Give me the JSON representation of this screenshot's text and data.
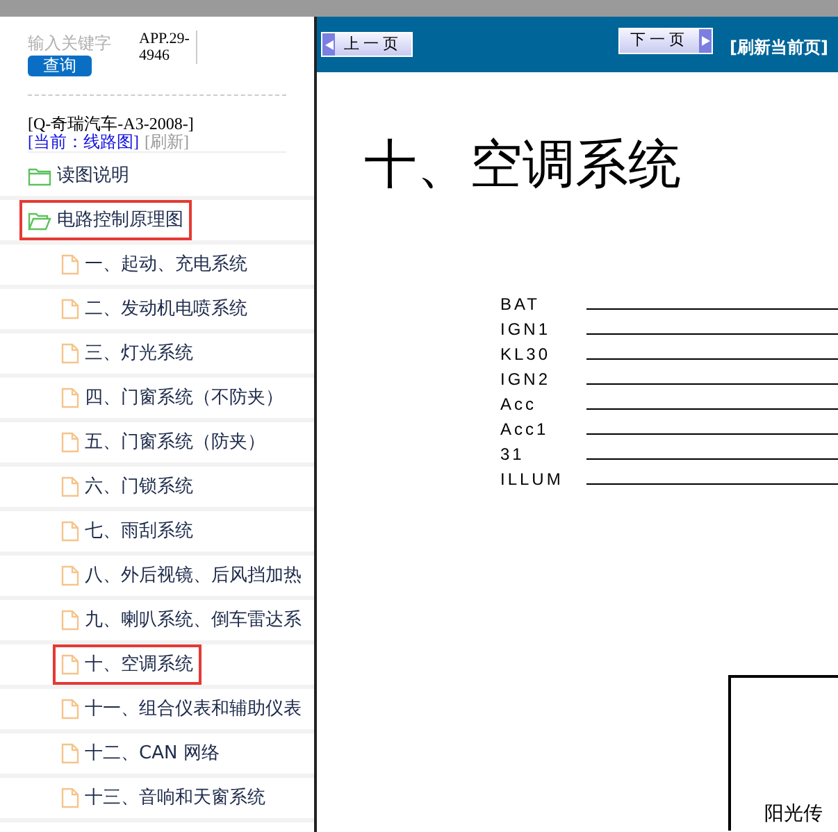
{
  "search": {
    "placeholder": "输入关键字",
    "button": "查询",
    "app_code": "APP.29-4946"
  },
  "vehicle": "[Q-奇瑞汽车-A3-2008-]",
  "current": "[当前：线路图]",
  "refresh": "[刷新]",
  "tree": [
    {
      "label": "读图说明",
      "kind": "folder",
      "expanded": false,
      "highlighted": false
    },
    {
      "label": "电路控制原理图",
      "kind": "folder",
      "expanded": true,
      "highlighted": true,
      "children": [
        {
          "label": "一、起动、充电系统",
          "kind": "page",
          "highlighted": false
        },
        {
          "label": "二、发动机电喷系统",
          "kind": "page",
          "highlighted": false
        },
        {
          "label": "三、灯光系统",
          "kind": "page",
          "highlighted": false
        },
        {
          "label": "四、门窗系统（不防夹）",
          "kind": "page",
          "highlighted": false
        },
        {
          "label": "五、门窗系统（防夹）",
          "kind": "page",
          "highlighted": false
        },
        {
          "label": "六、门锁系统",
          "kind": "page",
          "highlighted": false
        },
        {
          "label": "七、雨刮系统",
          "kind": "page",
          "highlighted": false
        },
        {
          "label": "八、外后视镜、后风挡加热",
          "kind": "page",
          "highlighted": false
        },
        {
          "label": "九、喇叭系统、倒车雷达系",
          "kind": "page",
          "highlighted": false
        },
        {
          "label": "十、空调系统",
          "kind": "page",
          "highlighted": true
        },
        {
          "label": "十一、组合仪表和辅助仪表",
          "kind": "page",
          "highlighted": false
        },
        {
          "label": "十二、CAN 网络",
          "kind": "page",
          "highlighted": false
        },
        {
          "label": "十三、音响和天窗系统",
          "kind": "page",
          "highlighted": false
        }
      ]
    }
  ],
  "toolbar": {
    "prev": "上一页",
    "next": "下一页",
    "refresh_page": "[刷新当前页]"
  },
  "document": {
    "title": "十、空调系统",
    "signals": [
      "BAT",
      "IGN1",
      "KL30",
      "IGN2",
      "Acc",
      "Acc1",
      "31",
      "ILLUM"
    ],
    "box_label": "阳光传"
  }
}
